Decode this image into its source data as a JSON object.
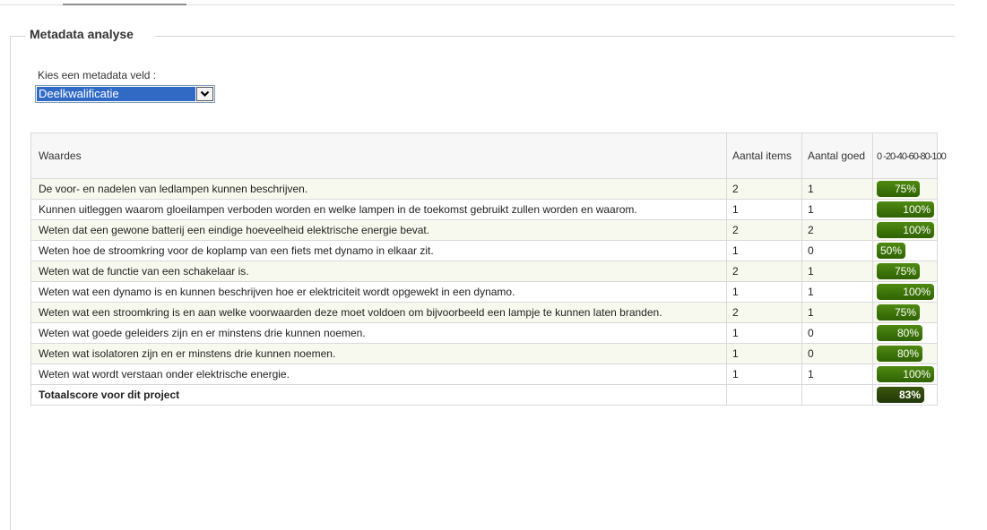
{
  "section": {
    "legend": "Metadata analyse"
  },
  "selector": {
    "label": "Kies een metadata veld :",
    "selected": "Deelkwalificatie"
  },
  "table": {
    "columns": [
      "Waardes",
      "Aantal items",
      "Aantal goed",
      "0 -20-40-60-80-100"
    ],
    "rows": [
      {
        "waarde": "De voor- en nadelen van ledlampen kunnen beschrijven.",
        "items": "2",
        "goed": "1",
        "score": 75,
        "score_label": "75%"
      },
      {
        "waarde": "Kunnen uitleggen waarom gloeilampen verboden worden en welke lampen in de toekomst gebruikt zullen worden en waarom.",
        "items": "1",
        "goed": "1",
        "score": 100,
        "score_label": "100%"
      },
      {
        "waarde": "Weten dat een gewone batterij een eindige hoeveelheid elektrische energie bevat.",
        "items": "2",
        "goed": "2",
        "score": 100,
        "score_label": "100%"
      },
      {
        "waarde": "Weten hoe de stroomkring voor de koplamp van een fiets met dynamo in elkaar zit.",
        "items": "1",
        "goed": "0",
        "score": 50,
        "score_label": "50%"
      },
      {
        "waarde": "Weten wat de functie van een schakelaar is.",
        "items": "2",
        "goed": "1",
        "score": 75,
        "score_label": "75%"
      },
      {
        "waarde": "Weten wat een dynamo is en kunnen beschrijven hoe er elektriciteit wordt opgewekt in een dynamo.",
        "items": "1",
        "goed": "1",
        "score": 100,
        "score_label": "100%"
      },
      {
        "waarde": "Weten wat een stroomkring is en aan welke voorwaarden deze moet voldoen om bijvoorbeeld een lampje te kunnen laten branden.",
        "items": "2",
        "goed": "1",
        "score": 75,
        "score_label": "75%"
      },
      {
        "waarde": "Weten wat goede geleiders zijn en er minstens drie kunnen noemen.",
        "items": "1",
        "goed": "0",
        "score": 80,
        "score_label": "80%"
      },
      {
        "waarde": "Weten wat isolatoren zijn en er minstens drie kunnen noemen.",
        "items": "1",
        "goed": "0",
        "score": 80,
        "score_label": "80%"
      },
      {
        "waarde": "Weten wat wordt verstaan onder elektrische energie.",
        "items": "1",
        "goed": "1",
        "score": 100,
        "score_label": "100%"
      }
    ],
    "total": {
      "label": "Totaalscore voor dit project",
      "score": 83,
      "score_label": "83%"
    }
  },
  "colors": {
    "bar": "#3f7a0a",
    "bar_total": "#2e4a0c",
    "selection": "#316ac5",
    "row_alt": "#f8f9ee"
  },
  "icons": {
    "dropdown": "chevron-down-icon"
  }
}
